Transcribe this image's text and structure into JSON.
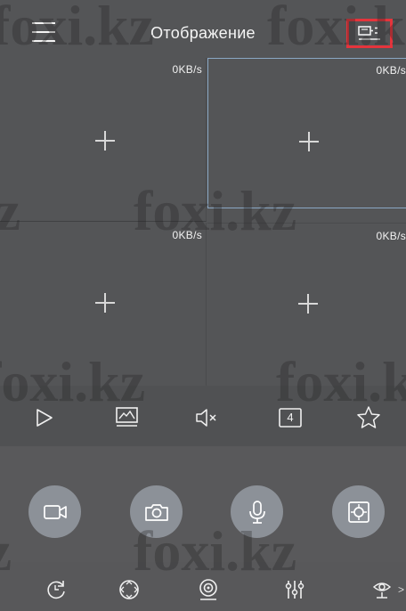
{
  "header": {
    "title": "Отображение",
    "menu_icon": "menu-icon",
    "device_icon": "device-list-icon"
  },
  "grid": {
    "cells": [
      {
        "speed": "0KB/s",
        "icon": "add-camera-icon",
        "selected": false
      },
      {
        "speed": "0KB/s",
        "icon": "add-camera-icon",
        "selected": true
      },
      {
        "speed": "0KB/s",
        "icon": "add-camera-icon",
        "selected": false
      },
      {
        "speed": "0KB/s",
        "icon": "add-camera-icon",
        "selected": false
      }
    ]
  },
  "toolbar": {
    "play_icon": "play-icon",
    "stream_icon": "image-quality-icon",
    "mute_icon": "speaker-muted-icon",
    "split_label": "4",
    "favorite_icon": "star-icon"
  },
  "controls": {
    "record_icon": "video-record-icon",
    "snapshot_icon": "camera-snapshot-icon",
    "talk_icon": "microphone-icon",
    "ptz_icon": "ptz-icon"
  },
  "bottom_bar": {
    "playback_icon": "playback-icon",
    "ptz_dir_icon": "ptz-direction-icon",
    "fisheye_icon": "fisheye-icon",
    "adjust_icon": "adjust-icon",
    "cruise_icon": "cruise-icon",
    "more_label": ">"
  },
  "watermark": {
    "text": "foxi.kz"
  },
  "colors": {
    "background": "#545557",
    "highlight": "#e5343c",
    "selected_border": "#8aa7c4",
    "button_bg": "#8c9198"
  }
}
